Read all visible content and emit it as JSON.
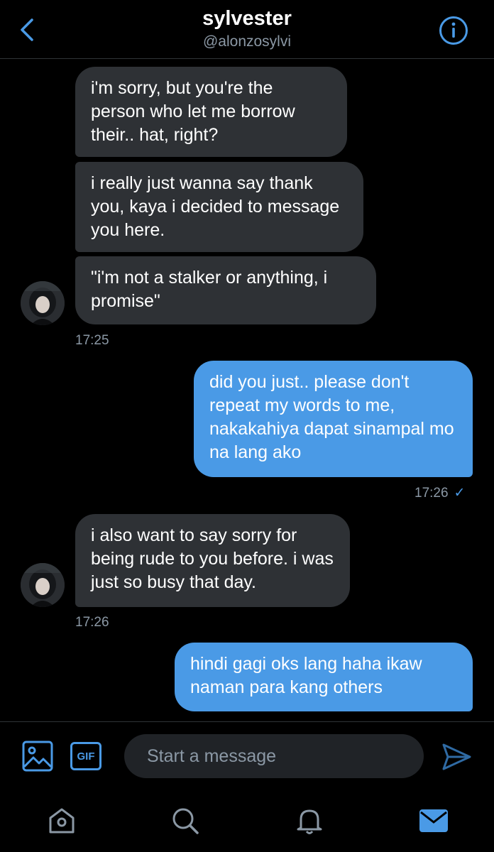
{
  "header": {
    "title": "sylvester",
    "handle": "@alonzosylvi",
    "back_icon": "chevron-left-icon",
    "info_icon": "info-icon"
  },
  "messages": [
    {
      "side": "in",
      "text": "i'm sorry, but you're the person who let me borrow their.. hat, right?"
    },
    {
      "side": "in",
      "text": "i really just wanna say thank you, kaya i decided to message you here."
    },
    {
      "side": "in",
      "text": "\"i'm not a stalker or anything, i promise\""
    },
    {
      "side": "out",
      "text": "did you just.. please don't repeat my words to me, nakakahiya dapat sinampal mo na lang ako"
    },
    {
      "side": "in",
      "text": "i also want to say sorry for being rude to you before. i was just so busy that day."
    },
    {
      "side": "out",
      "text": "hindi gagi oks lang haha ikaw naman para kang others"
    }
  ],
  "timestamps": {
    "first_group": "17:25",
    "sent_reply": "17:26",
    "sent_check": "✓",
    "second_group": "17:26"
  },
  "composer": {
    "placeholder": "Start a message",
    "media_icon": "image-icon",
    "gif_label": "GIF",
    "send_icon": "send-icon"
  },
  "nav": {
    "items": [
      "home-icon",
      "search-icon",
      "notifications-icon",
      "messages-icon"
    ],
    "active": "messages-icon"
  },
  "colors": {
    "accent": "#4a9ae6",
    "incoming_bubble": "#2e3135",
    "outgoing_bubble": "#4a9ae6",
    "muted_text": "#8b98a5",
    "background": "#000000"
  }
}
